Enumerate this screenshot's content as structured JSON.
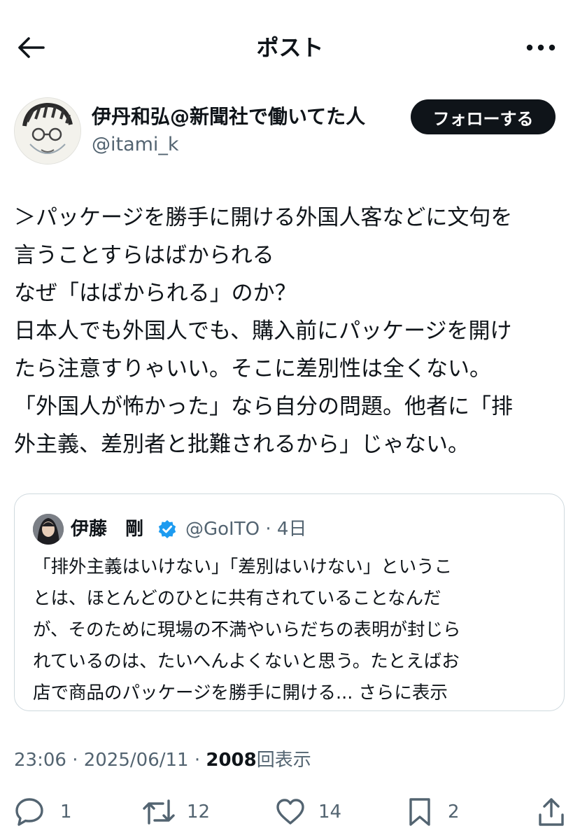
{
  "header": {
    "title": "ポスト",
    "back_icon": "arrow-left-icon",
    "more_icon": "more-horizontal-icon"
  },
  "post": {
    "author_name": "伊丹和弘@新聞社で働いてた人",
    "author_handle": "@itami_k",
    "follow_label": "フォローする",
    "body_lines": [
      "＞パッケージを勝手に開ける外国人客などに文句を",
      "言うことすらはばかられる",
      "なぜ「はばかられる」のか？",
      "日本人でも外国人でも、購入前にパッケージを開け",
      "たら注意すりゃいい。そこに差別性は全くない。",
      "「外国人が怖かった」なら自分の問題。他者に「排",
      "外主義、差別者と批難されるから」じゃない。"
    ],
    "timestamp": "23:06 · 2025/06/11 · ",
    "views_count": "2008",
    "views_label": "回表示"
  },
  "quote": {
    "name": "伊藤　剛",
    "handle_time": "@GoITO · 4日",
    "text_lines": [
      "「排外主義はいけない」「差別はいけない」というこ",
      "とは、ほとんどのひとに共有されていることなんだ",
      "が、そのために現場の不満やいらだちの表明が封じら",
      "れているのは、たいへんよくないと思う。たとえばお",
      "店で商品のパッケージを勝手に開ける..."
    ],
    "show_more": "さらに表示",
    "verified_color": "#1d9bf0"
  },
  "actions": {
    "reply_count": "1",
    "repost_count": "12",
    "like_count": "14",
    "bookmark_count": "2"
  }
}
